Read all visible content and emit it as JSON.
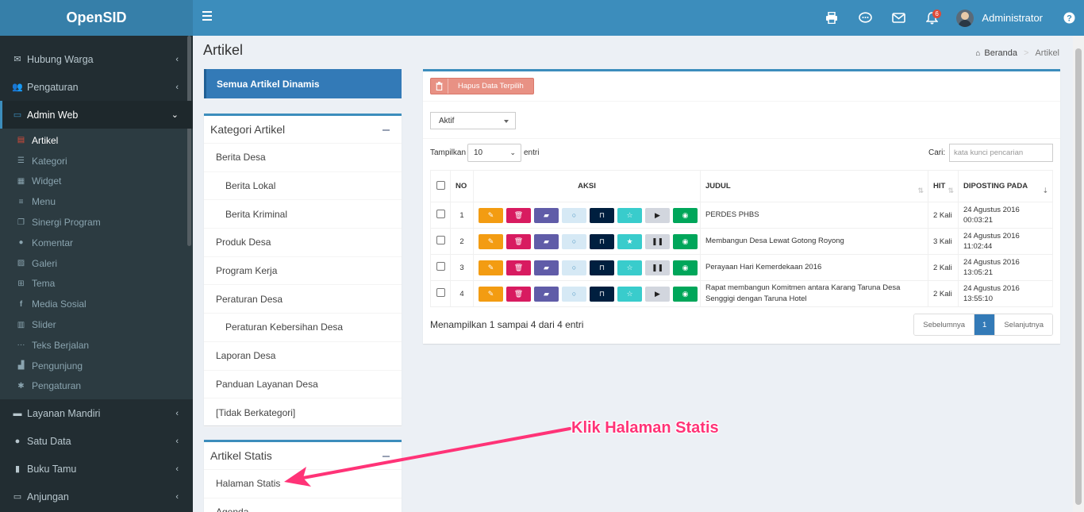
{
  "app": {
    "name": "OpenSID"
  },
  "header": {
    "user_name": "Administrator",
    "notification_count": "6",
    "icons": [
      "print-icon",
      "chat-icon",
      "envelope-icon",
      "bell-icon",
      "help-icon"
    ]
  },
  "sidebar": {
    "menu_top": [
      {
        "label": "Hubung Warga",
        "icon": "envelope-icon"
      },
      {
        "label": "Pengaturan",
        "icon": "users-icon"
      },
      {
        "label": "Admin Web",
        "icon": "monitor-icon"
      }
    ],
    "submenu": [
      {
        "label": "Artikel",
        "icon": "file-icon"
      },
      {
        "label": "Kategori",
        "icon": "list-icon"
      },
      {
        "label": "Widget",
        "icon": "grid-icon"
      },
      {
        "label": "Menu",
        "icon": "bars-icon"
      },
      {
        "label": "Sinergi Program",
        "icon": "clone-icon"
      },
      {
        "label": "Komentar",
        "icon": "comments-icon"
      },
      {
        "label": "Galeri",
        "icon": "image-icon"
      },
      {
        "label": "Tema",
        "icon": "theme-icon"
      },
      {
        "label": "Media Sosial",
        "icon": "facebook-icon"
      },
      {
        "label": "Slider",
        "icon": "film-icon"
      },
      {
        "label": "Teks Berjalan",
        "icon": "ellipsis-icon"
      },
      {
        "label": "Pengunjung",
        "icon": "chart-icon"
      },
      {
        "label": "Pengaturan",
        "icon": "gear-icon"
      }
    ],
    "menu_bottom": [
      {
        "label": "Layanan Mandiri",
        "icon": "car-icon"
      },
      {
        "label": "Satu Data",
        "icon": "globe-icon"
      },
      {
        "label": "Buku Tamu",
        "icon": "book-icon"
      },
      {
        "label": "Anjungan",
        "icon": "monitor-icon"
      }
    ]
  },
  "page": {
    "title": "Artikel",
    "breadcrumb_home": "Beranda",
    "breadcrumb_current": "Artikel"
  },
  "left": {
    "all_dynamic_btn": "Semua Artikel Dinamis",
    "kategori_title": "Kategori Artikel",
    "kategori_items": [
      {
        "label": "Berita Desa",
        "indent": false
      },
      {
        "label": "Berita Lokal",
        "indent": true
      },
      {
        "label": "Berita Kriminal",
        "indent": true
      },
      {
        "label": "Produk Desa",
        "indent": false
      },
      {
        "label": "Program Kerja",
        "indent": false
      },
      {
        "label": "Peraturan Desa",
        "indent": false
      },
      {
        "label": "Peraturan Kebersihan Desa",
        "indent": true
      },
      {
        "label": "Laporan Desa",
        "indent": false
      },
      {
        "label": "Panduan Layanan Desa",
        "indent": false
      },
      {
        "label": "[Tidak Berkategori]",
        "indent": false
      }
    ],
    "statis_title": "Artikel Statis",
    "statis_items": [
      "Halaman Statis",
      "Agenda"
    ]
  },
  "main": {
    "delete_btn": "Hapus Data Terpilih",
    "status_value": "Aktif",
    "show_label": "Tampilkan",
    "show_value": "10",
    "entries_label": "entri",
    "search_label": "Cari:",
    "search_placeholder": "kata kunci pencarian",
    "columns": [
      "NO",
      "AKSI",
      "JUDUL",
      "HIT",
      "DIPOSTING PADA"
    ],
    "rows": [
      {
        "no": "1",
        "judul": "PERDES PHBS",
        "hit": "2 Kali",
        "date": "24 Agustus 2016",
        "time": "00:03:21",
        "featured": false,
        "playing": false
      },
      {
        "no": "2",
        "judul": "Membangun Desa Lewat Gotong Royong",
        "hit": "3 Kali",
        "date": "24 Agustus 2016",
        "time": "11:02:44",
        "featured": true,
        "playing": true
      },
      {
        "no": "3",
        "judul": "Perayaan Hari Kemerdekaan 2016",
        "hit": "2 Kali",
        "date": "24 Agustus 2016",
        "time": "13:05:21",
        "featured": false,
        "playing": true
      },
      {
        "no": "4",
        "judul": "Rapat membangun Komitmen antara Karang Taruna Desa Senggigi dengan Taruna Hotel",
        "hit": "2 Kali",
        "date": "24 Agustus 2016",
        "time": "13:55:10",
        "featured": false,
        "playing": false
      }
    ],
    "info_text": "Menampilkan 1 sampai 4 dari 4 entri",
    "pager_prev": "Sebelumnya",
    "pager_current": "1",
    "pager_next": "Selanjutnya"
  },
  "annotation": {
    "text": "Klik Halaman Statis",
    "color": "#ff3377"
  },
  "colors": {
    "primary": "#3c8dbc",
    "sidebar_bg": "#222d32",
    "accent_blue": "#337ab7"
  }
}
